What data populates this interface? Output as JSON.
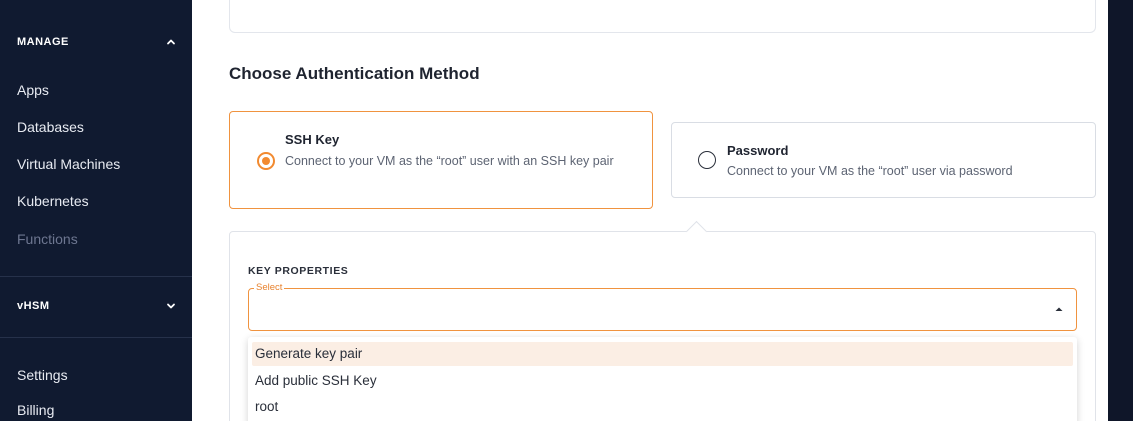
{
  "sidebar": {
    "manage_header": "MANAGE",
    "manage_items": [
      "Apps",
      "Databases",
      "Virtual Machines",
      "Kubernetes",
      "Functions"
    ],
    "vhsm_header": "vHSM",
    "bottom_items": [
      "Settings",
      "Billing"
    ]
  },
  "main": {
    "section_title": "Choose Authentication Method",
    "auth_options": [
      {
        "title": "SSH Key",
        "description": "Connect to your VM as the “root” user with an SSH key pair",
        "selected": true
      },
      {
        "title": "Password",
        "description": "Connect to your VM as the “root” user via password",
        "selected": false
      }
    ],
    "key_properties": {
      "label": "KEY PROPERTIES",
      "select_legend": "Select",
      "options": [
        "Generate key pair",
        "Add public SSH Key",
        "root"
      ],
      "highlighted_option": "Generate key pair"
    }
  },
  "colors": {
    "sidebar_bg": "#101a30",
    "accent": "#f28a30",
    "highlight_bg": "#fbeee4"
  },
  "icons": {
    "manage_toggle": "chevron-up-icon",
    "vhsm_toggle": "chevron-down-icon",
    "select_caret": "caret-up-icon"
  }
}
